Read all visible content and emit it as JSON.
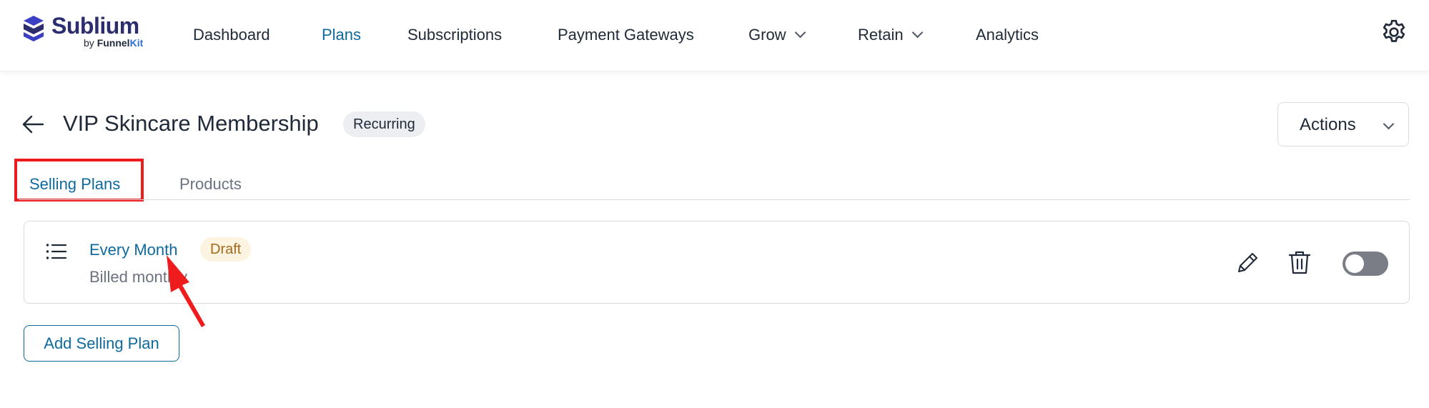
{
  "brand": {
    "name": "Sublium",
    "byline_prefix": "by",
    "byline_brand": "Funnel",
    "byline_brand_suffix": "Kit",
    "mark_color": "#3b3fc4"
  },
  "nav": {
    "items": [
      {
        "label": "Dashboard",
        "active": false,
        "has_dropdown": false
      },
      {
        "label": "Plans",
        "active": true,
        "has_dropdown": false
      },
      {
        "label": "Subscriptions",
        "active": false,
        "has_dropdown": false
      },
      {
        "label": "Payment Gateways",
        "active": false,
        "has_dropdown": false
      },
      {
        "label": "Grow",
        "active": false,
        "has_dropdown": true
      },
      {
        "label": "Retain",
        "active": false,
        "has_dropdown": true
      },
      {
        "label": "Analytics",
        "active": false,
        "has_dropdown": false
      }
    ],
    "settings_icon": "gear-icon"
  },
  "header": {
    "title": "VIP Skincare Membership",
    "type_badge": "Recurring",
    "actions_label": "Actions",
    "back_icon": "arrow-left-icon"
  },
  "tabs": [
    {
      "label": "Selling Plans",
      "active": true
    },
    {
      "label": "Products",
      "active": false
    }
  ],
  "plans": [
    {
      "name": "Every Month",
      "status": "Draft",
      "billing": "Billed monthly",
      "enabled": false
    }
  ],
  "add_plan_label": "Add Selling Plan",
  "colors": {
    "accent": "#0e6a9e",
    "highlight": "#ee1c1c",
    "draft_badge_bg": "#fdf3e1",
    "draft_badge_text": "#a36a1c",
    "toggle_off": "#7a7d85"
  }
}
